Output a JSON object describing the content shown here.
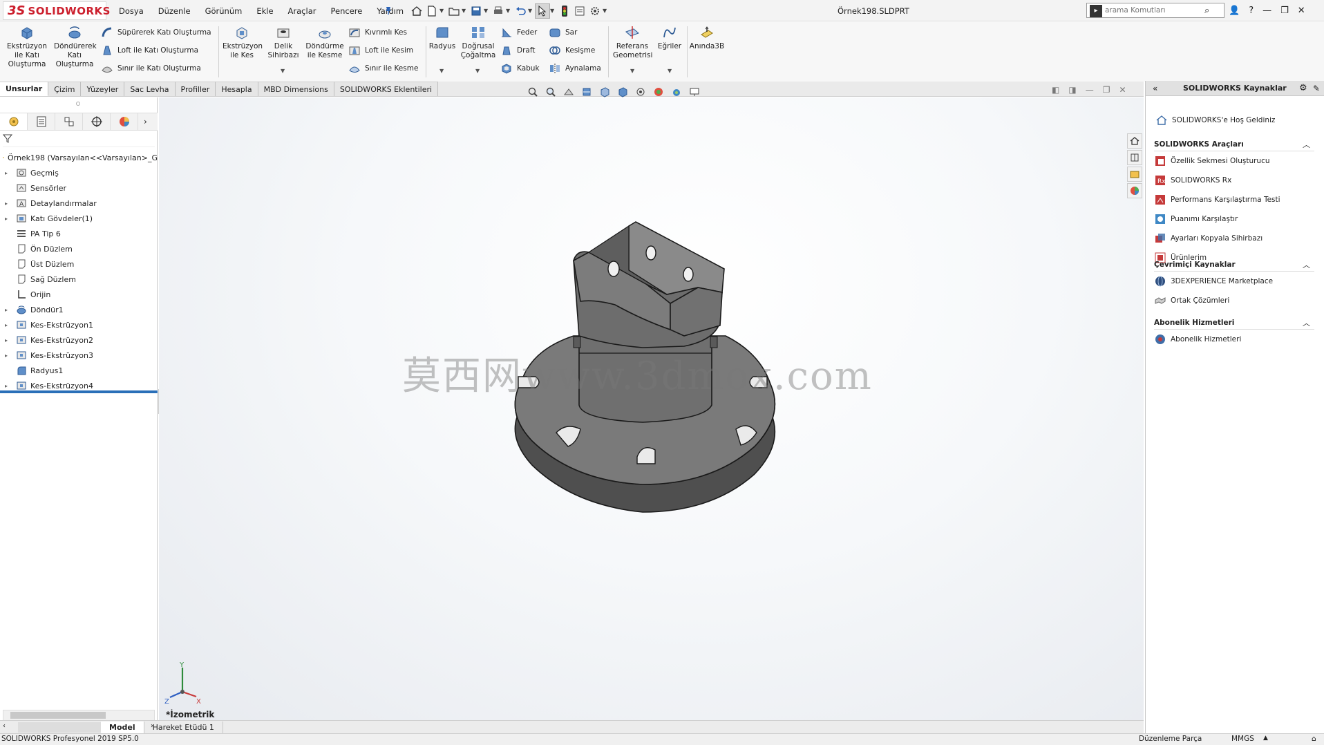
{
  "app": {
    "logo_ds": "3S",
    "logo_name": "SOLIDWORKS",
    "doc_title": "Örnek198.SLDPRT"
  },
  "menu": [
    "Dosya",
    "Düzenle",
    "Görünüm",
    "Ekle",
    "Araçlar",
    "Pencere",
    "Yardım"
  ],
  "search": {
    "placeholder": "arama Komutları"
  },
  "cmd": {
    "extrude_boss": "Ekstrüzyon ile Katı Oluşturma",
    "revolve_boss": "Döndürerek Katı Oluşturma",
    "swept_boss": "Süpürerek Katı Oluşturma",
    "loft_boss": "Loft ile Katı Oluşturma",
    "boundary_boss": "Sınır ile Katı Oluşturma",
    "extrude_cut": "Ekstrüzyon ile Kes",
    "hole_wizard": "Delik Sihirbazı",
    "revolve_cut": "Döndürme ile Kesme",
    "swept_cut": "Kıvrımlı Kes",
    "loft_cut": "Loft ile Kesim",
    "boundary_cut": "Sınır ile Kesme",
    "fillet": "Radyus",
    "linear_pattern": "Doğrusal Çoğaltma",
    "rib": "Feder",
    "draft": "Draft",
    "shell": "Kabuk",
    "wrap": "Sar",
    "intersect": "Kesişme",
    "mirror": "Aynalama",
    "ref_geometry": "Referans Geometrisi",
    "curves": "Eğriler",
    "instant3d": "Anında3B"
  },
  "tabs": [
    "Unsurlar",
    "Çizim",
    "Yüzeyler",
    "Sac Levha",
    "Profiller",
    "Hesapla",
    "MBD Dimensions",
    "SOLIDWORKS Eklentileri"
  ],
  "tree": {
    "root": "Örnek198  (Varsayılan<<Varsayılan>_G",
    "nodes": [
      {
        "label": "Geçmiş",
        "icon": "history-folder-icon"
      },
      {
        "label": "Sensörler",
        "icon": "sensor-folder-icon"
      },
      {
        "label": "Detaylandırmalar",
        "icon": "annotations-icon"
      },
      {
        "label": "Katı Gövdeler(1)",
        "icon": "solid-bodies-icon"
      },
      {
        "label": "PA Tip 6",
        "icon": "material-icon"
      },
      {
        "label": "Ön Düzlem",
        "icon": "plane-icon"
      },
      {
        "label": "Üst Düzlem",
        "icon": "plane-icon"
      },
      {
        "label": "Sağ Düzlem",
        "icon": "plane-icon"
      },
      {
        "label": "Orijin",
        "icon": "origin-icon"
      },
      {
        "label": "Döndür1",
        "icon": "revolve-feature-icon"
      },
      {
        "label": "Kes-Ekstrüzyon1",
        "icon": "cut-extrude-icon"
      },
      {
        "label": "Kes-Ekstrüzyon2",
        "icon": "cut-extrude-icon"
      },
      {
        "label": "Kes-Ekstrüzyon3",
        "icon": "cut-extrude-icon"
      },
      {
        "label": "Radyus1",
        "icon": "fillet-feature-icon"
      },
      {
        "label": "Kes-Ekstrüzyon4",
        "icon": "cut-extrude-icon"
      }
    ]
  },
  "graphics": {
    "view_name": "*İzometrik",
    "watermark": "莫西网www.3dmox.com",
    "triad_labels": [
      "Y",
      "Z",
      "X"
    ]
  },
  "bottom_tabs": [
    "Model",
    "Hareket Etüdü 1"
  ],
  "taskpane": {
    "title": "SOLIDWORKS Kaynaklar",
    "welcome": "SOLIDWORKS'e Hoş Geldiniz",
    "sections": [
      {
        "title": "SOLIDWORKS Araçları",
        "items": [
          "Özellik Sekmesi Oluşturucu",
          "SOLIDWORKS Rx",
          "Performans Karşılaştırma Testi",
          "Puanımı Karşılaştır",
          "Ayarları Kopyala Sihirbazı",
          "Ürünlerim"
        ]
      },
      {
        "title": "Çevrimiçi Kaynaklar",
        "items": [
          "3DEXPERIENCE Marketplace",
          "Ortak Çözümleri"
        ]
      },
      {
        "title": "Abonelik Hizmetleri",
        "items": [
          "Abonelik Hizmetleri"
        ]
      }
    ]
  },
  "status": {
    "version": "SOLIDWORKS Profesyonel 2019 SP5.0",
    "mode": "Düzenleme Parça",
    "units": "MMGS"
  },
  "colors": {
    "brand_red": "#cc1f2d",
    "accent_blue": "#2a6fb8",
    "part_gray": "#6f6f6f"
  }
}
